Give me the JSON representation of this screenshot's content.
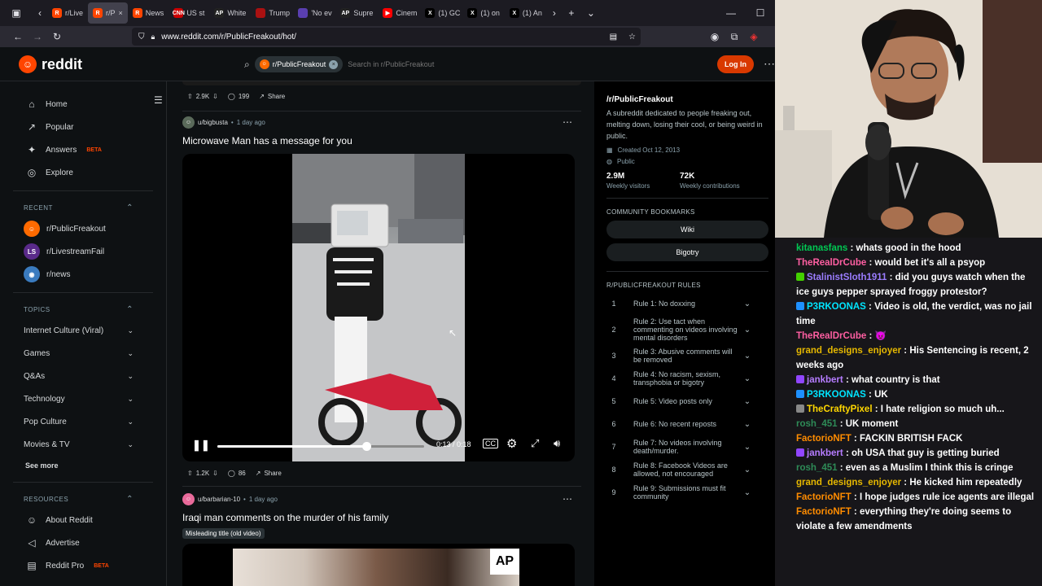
{
  "browser": {
    "tabs": [
      {
        "label": "r/Live",
        "fav": "R",
        "color": "#ff4500",
        "active": false
      },
      {
        "label": "r/P",
        "fav": "R",
        "color": "#ff4500",
        "active": true
      },
      {
        "label": "News",
        "fav": "R",
        "color": "#ff4500",
        "active": false
      },
      {
        "label": "US st",
        "fav": "CNN",
        "color": "#cc0000",
        "active": false
      },
      {
        "label": "White",
        "fav": "AP",
        "color": "#222222",
        "active": false
      },
      {
        "label": "Trump",
        "fav": "",
        "color": "#aa1111",
        "active": false
      },
      {
        "label": "'No ev",
        "fav": "",
        "color": "#5a3fb0",
        "active": false
      },
      {
        "label": "Supre",
        "fav": "AP",
        "color": "#222222",
        "active": false
      },
      {
        "label": "Cinem",
        "fav": "▶",
        "color": "#ff0000",
        "active": false
      },
      {
        "label": "(1) GC",
        "fav": "X",
        "color": "#000000",
        "active": false
      },
      {
        "label": "(1) on",
        "fav": "X",
        "color": "#000000",
        "active": false
      },
      {
        "label": "(1) An",
        "fav": "X",
        "color": "#000000",
        "active": false
      }
    ],
    "url": "www.reddit.com/r/PublicFreakout/hot/"
  },
  "reddit": {
    "logo_text": "reddit",
    "search_chip": "r/PublicFreakout",
    "search_placeholder": "Search in r/PublicFreakout",
    "login_label": "Log In"
  },
  "leftnav": {
    "main": [
      {
        "label": "Home",
        "icon": "home-icon",
        "glyph": "⌂"
      },
      {
        "label": "Popular",
        "icon": "popular-icon",
        "glyph": "↗"
      },
      {
        "label": "Answers",
        "icon": "answers-icon",
        "glyph": "✦",
        "badge": "BETA"
      },
      {
        "label": "Explore",
        "icon": "explore-icon",
        "glyph": "◎"
      }
    ],
    "recent_heading": "RECENT",
    "recent": [
      {
        "label": "r/PublicFreakout",
        "avatar_color": "#ff6a00",
        "avatar_text": "☺"
      },
      {
        "label": "r/LivestreamFail",
        "avatar_color": "#5a2a8a",
        "avatar_text": "LS"
      },
      {
        "label": "r/news",
        "avatar_color": "#3a7bbf",
        "avatar_text": "◉"
      }
    ],
    "topics_heading": "TOPICS",
    "topics": [
      "Internet Culture (Viral)",
      "Games",
      "Q&As",
      "Technology",
      "Pop Culture",
      "Movies & TV"
    ],
    "see_more": "See more",
    "resources_heading": "RESOURCES",
    "resources": [
      {
        "label": "About Reddit",
        "icon": "reddit-icon",
        "glyph": "☺"
      },
      {
        "label": "Advertise",
        "icon": "megaphone-icon",
        "glyph": "◁"
      },
      {
        "label": "Reddit Pro",
        "icon": "pro-icon",
        "glyph": "▤",
        "badge": "BETA"
      }
    ]
  },
  "feed": {
    "prev_post": {
      "upvotes": "2.9K",
      "comments": "199",
      "share": "Share"
    },
    "post1": {
      "author": "u/bigbusta",
      "time": "1 day ago",
      "title": "Microwave Man has a message for you",
      "video_time": "0:13 / 0:18",
      "progress": 0.72,
      "upvotes": "1.2K",
      "comments": "86",
      "share": "Share"
    },
    "post2": {
      "author": "u/barbarian-10",
      "time": "1 day ago",
      "title": "Iraqi man comments on the murder of his family",
      "flair": "Misleading title (old video)",
      "thumb_logo": "AP"
    }
  },
  "sidebar": {
    "sub_name": "/r/PublicFreakout",
    "description": "A subreddit dedicated to people freaking out, melting down, losing their cool, or being weird in public.",
    "created": "Created Oct 12, 2013",
    "visibility": "Public",
    "visitors_value": "2.9M",
    "visitors_label": "Weekly visitors",
    "contrib_value": "72K",
    "contrib_label": "Weekly contributions",
    "bookmarks_heading": "COMMUNITY BOOKMARKS",
    "bookmarks": [
      "Wiki",
      "Bigotry"
    ],
    "rules_heading": "R/PUBLICFREAKOUT RULES",
    "rules": [
      {
        "num": "1",
        "text": "Rule 1: No doxxing"
      },
      {
        "num": "2",
        "text": "Rule 2: Use tact when commenting on videos involving mental disorders"
      },
      {
        "num": "3",
        "text": "Rule 3: Abusive comments will be removed"
      },
      {
        "num": "4",
        "text": "Rule 4: No racism, sexism, transphobia or bigotry"
      },
      {
        "num": "5",
        "text": "Rule 5: Video posts only"
      },
      {
        "num": "6",
        "text": "Rule 6: No recent reposts"
      },
      {
        "num": "7",
        "text": "Rule 7: No videos involving death/murder."
      },
      {
        "num": "8",
        "text": "Rule 8: Facebook Videos are allowed, not encouraged"
      },
      {
        "num": "9",
        "text": "Rule 9: Submissions must fit community"
      }
    ]
  },
  "chat": [
    {
      "user": "kitanasfans",
      "color": "#00c853",
      "badge": "",
      "text": "whats good in the hood"
    },
    {
      "user": "TheRealDrCube",
      "color": "#ff5fa2",
      "badge": "",
      "text": "would bet it's all a psyop"
    },
    {
      "user": "StalinistSloth1911",
      "color": "#9b7dff",
      "badge": "#43d000",
      "text": "did you guys watch when the ice guys pepper sprayed froggy protestor?"
    },
    {
      "user": "P3RKOONAS",
      "color": "#00e5ff",
      "badge": "#1e90ff",
      "text": "Video is old, the verdict, was no jail time"
    },
    {
      "user": "TheRealDrCube",
      "color": "#ff5fa2",
      "badge": "",
      "text": "😈"
    },
    {
      "user": "grand_designs_enjoyer",
      "color": "#e6b800",
      "badge": "",
      "text": "His Sentencing is recent, 2 weeks ago"
    },
    {
      "user": "jankbert",
      "color": "#b57cff",
      "badge": "#9146ff",
      "text": "what country is that"
    },
    {
      "user": "P3RKOONAS",
      "color": "#00e5ff",
      "badge": "#1e90ff",
      "text": "UK"
    },
    {
      "user": "TheCraftyPixel",
      "color": "#ffd700",
      "badge": "#888888",
      "text": "I hate religion so much uh..."
    },
    {
      "user": "rosh_451",
      "color": "#2e8b57",
      "badge": "",
      "text": "UK moment"
    },
    {
      "user": "FactorioNFT",
      "color": "#ff8c00",
      "badge": "",
      "text": "FACKIN BRITISH FACK"
    },
    {
      "user": "jankbert",
      "color": "#b57cff",
      "badge": "#9146ff",
      "text": "oh USA that guy is getting buried"
    },
    {
      "user": "rosh_451",
      "color": "#2e8b57",
      "badge": "",
      "text": "even as a Muslim I think this is cringe"
    },
    {
      "user": "grand_designs_enjoyer",
      "color": "#e6b800",
      "badge": "",
      "text": "He kicked him repeatedly"
    },
    {
      "user": "FactorioNFT",
      "color": "#ff8c00",
      "badge": "",
      "text": "I hope judges rule ice agents are illegal"
    },
    {
      "user": "FactorioNFT",
      "color": "#ff8c00",
      "badge": "",
      "text": "everything they're doing seems to violate a few amendments"
    }
  ]
}
